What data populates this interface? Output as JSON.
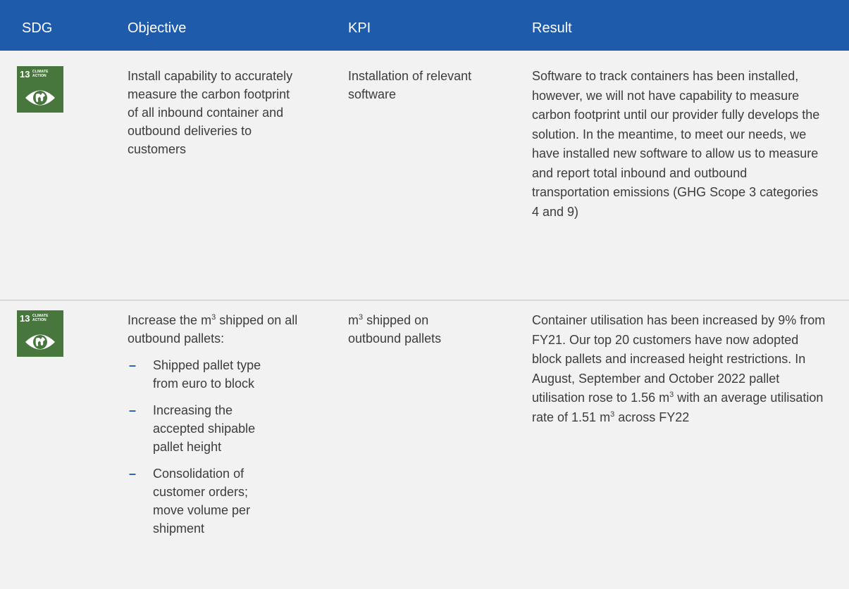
{
  "header": {
    "col_sdg": "SDG",
    "col_objective": "Objective",
    "col_kpi": "KPI",
    "col_result": "Result"
  },
  "sdg_badge": {
    "number": "13",
    "label_line1": "CLIMATE",
    "label_line2": "ACTION",
    "icon": "eye-globe-icon",
    "color": "#48773e"
  },
  "rows": [
    {
      "objective": "Install capability to accurately measure the carbon footprint of all inbound container and outbound deliveries to customers",
      "kpi": "Installation of relevant software",
      "result": "Software to track containers has been installed, however, we will not have capability to measure carbon footprint until our provider fully develops the solution. In the meantime, to meet our needs, we have installed new software to allow us to measure and report total inbound and outbound transportation emissions (GHG Scope 3 categories 4 and 9)"
    },
    {
      "objective_intro_pre": "Increase the m",
      "objective_intro_sup": "3",
      "objective_intro_post": " shipped on all outbound pallets:",
      "bullets": [
        "Shipped pallet type from euro to block",
        "Increasing the accepted shipable pallet height",
        "Consolidation of customer orders; move volume per shipment"
      ],
      "bullet_marker": "–",
      "kpi_pre": "m",
      "kpi_sup": "3",
      "kpi_post": " shipped on outbound pallets",
      "result_part1": "Container utilisation has been increased by 9% from FY21. Our top 20 customers have now adopted block pallets and increased height restrictions. In August, September and October 2022 pallet utilisation rose to 1.56 m",
      "result_sup1": "3",
      "result_part2": " with an average utilisation rate of 1.51 m",
      "result_sup2": "3",
      "result_part3": " across FY22"
    }
  ],
  "colors": {
    "header_bg": "#1f5bab",
    "page_bg": "#f2f2f2",
    "divider": "#c4c4c4",
    "bullet_dash": "#1f5bab"
  }
}
